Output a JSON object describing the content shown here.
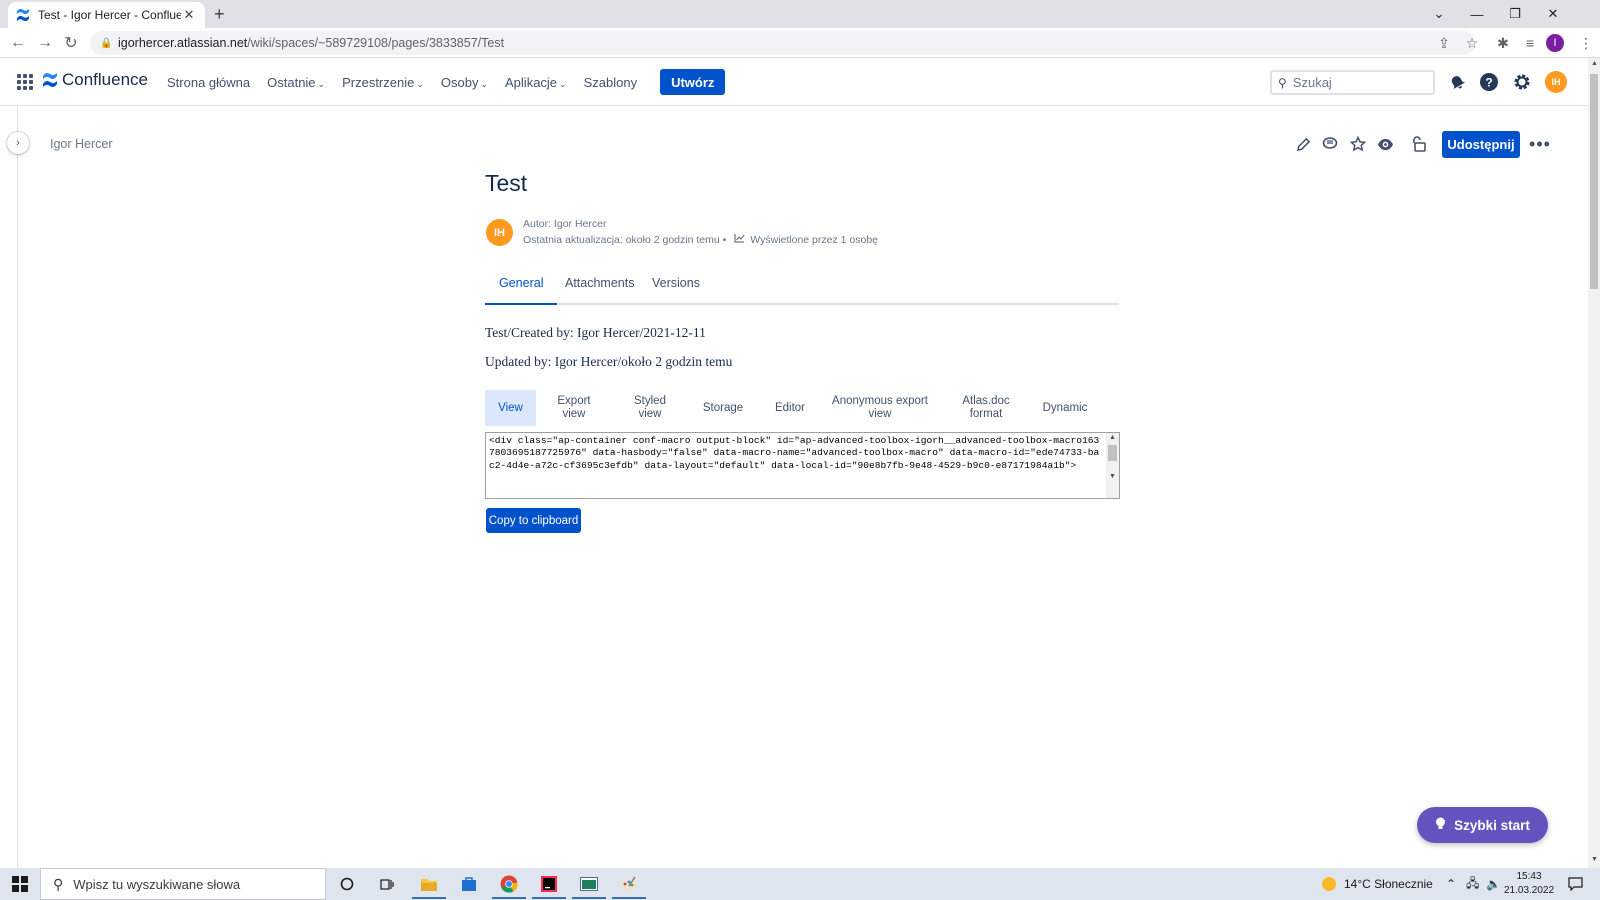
{
  "browser": {
    "tab_title": "Test - Igor Hercer - Confluence",
    "tab_close": "✕",
    "new_tab": "+",
    "url_host": "igorhercer.atlassian.net",
    "url_path": "/wiki/spaces/~589729108/pages/3833857/Test",
    "profile_initial": "I"
  },
  "header": {
    "logo": "Confluence",
    "nav": [
      "Strona główna",
      "Ostatnie",
      "Przestrzenie",
      "Osoby",
      "Aplikacje",
      "Szablony"
    ],
    "create_label": "Utwórz",
    "search_placeholder": "Szukaj",
    "avatar_initials": "IH"
  },
  "breadcrumb": "Igor Hercer",
  "share_label": "Udostępnij",
  "page": {
    "title": "Test",
    "author_line": "Autor: Igor Hercer",
    "updated_line": "Ostatnia aktualizacja: około 2 godzin temu •",
    "views_line": "Wyświetlone przez 1 osobę",
    "avatar_initials": "IH",
    "tabs": [
      "General",
      "Attachments",
      "Versions"
    ],
    "created_text": "Test/Created by: Igor Hercer/2021-12-11",
    "updated_text": "Updated by: Igor Hercer/około 2 godzin temu"
  },
  "toolbox": {
    "tabs": [
      "View",
      "Export view",
      "Styled view",
      "Storage",
      "Editor",
      "Anonymous export view",
      "Atlas.doc format",
      "Dynamic"
    ],
    "code": "<div class=\"ap-container conf-macro output-block\" id=\"ap-advanced-toolbox-igorh__advanced-toolbox-macro1637803695187725976\" data-hasbody=\"false\" data-macro-name=\"advanced-toolbox-macro\" data-macro-id=\"ede74733-bac2-4d4e-a72c-cf3695c3efdb\" data-layout=\"default\" data-local-id=\"90e8b7fb-9e48-4529-b9c0-e87171984a1b\">",
    "copy_label": "Copy to clipboard"
  },
  "quick_start": "Szybki start",
  "taskbar": {
    "search_placeholder": "Wpisz tu wyszukiwane słowa",
    "weather": "14°C  Słonecznie",
    "time": "15:43",
    "date": "21.03.2022"
  }
}
